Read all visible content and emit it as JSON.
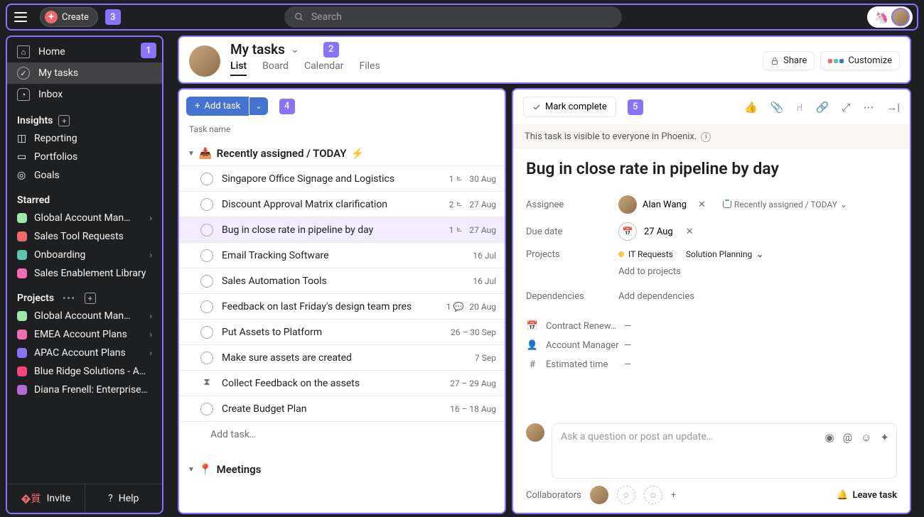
{
  "topbar": {
    "create_label": "Create",
    "badge": "3",
    "search_placeholder": "Search"
  },
  "sidebar": {
    "badge": "1",
    "nav": [
      {
        "label": "Home"
      },
      {
        "label": "My tasks"
      },
      {
        "label": "Inbox"
      }
    ],
    "insights_label": "Insights",
    "insights": [
      {
        "label": "Reporting"
      },
      {
        "label": "Portfolios"
      },
      {
        "label": "Goals"
      }
    ],
    "starred_label": "Starred",
    "starred": [
      {
        "label": "Global Account Man…",
        "color": "#9ee7a5",
        "chev": true
      },
      {
        "label": "Sales Tool Requests",
        "color": "#f06a6a"
      },
      {
        "label": "Onboarding",
        "color": "#5cc6b0",
        "chev": true
      },
      {
        "label": "Sales Enablement Library",
        "color": "#f56eb4"
      }
    ],
    "projects_label": "Projects",
    "projects": [
      {
        "label": "Global Account Man…",
        "color": "#9ee7a5",
        "chev": true
      },
      {
        "label": "EMEA Account Plans",
        "color": "#f56eb4",
        "chev": true
      },
      {
        "label": "APAC Account Plans",
        "color": "#8a72ff",
        "chev": true
      },
      {
        "label": "Blue Ridge Solutions - A…",
        "color": "#f8447c"
      },
      {
        "label": "Diana Frenell: Enterprise…",
        "color": "#b36bd4"
      }
    ],
    "invite_label": "Invite",
    "help_label": "Help"
  },
  "header": {
    "title": "My tasks",
    "badge": "2",
    "tabs": [
      "List",
      "Board",
      "Calendar",
      "Files"
    ],
    "share_label": "Share",
    "customize_label": "Customize"
  },
  "list": {
    "add_task_label": "Add task",
    "badge": "4",
    "column_label": "Task name",
    "section1_label": "Recently assigned / TODAY",
    "tasks": [
      {
        "name": "Singapore Office Signage and Logistics",
        "sub": "1",
        "date": "30 Aug"
      },
      {
        "name": "Discount Approval Matrix clarification",
        "sub": "2",
        "date": "27 Aug"
      },
      {
        "name": "Bug in close rate in pipeline by day",
        "sub": "1",
        "date": "27 Aug",
        "selected": true
      },
      {
        "name": "Email Tracking Software",
        "date": "16 Jul"
      },
      {
        "name": "Sales Automation Tools",
        "date": "16 Jul"
      },
      {
        "name": "Feedback on last Friday's design team pres",
        "comment": "1",
        "date": "20 Aug"
      },
      {
        "name": "Put Assets to Platform",
        "date": "26 – 30 Sep"
      },
      {
        "name": "Make sure assets are created",
        "date": "7 Sep"
      },
      {
        "name": "Collect Feedback on the assets",
        "hourglass": true,
        "date": "27 – 29 Aug"
      },
      {
        "name": "Create Budget Plan",
        "date": "16 – 18 Aug"
      }
    ],
    "add_task_inline": "Add task…",
    "section2_label": "Meetings"
  },
  "detail": {
    "mark_complete": "Mark complete",
    "badge": "5",
    "visibility_text": "This task is visible to everyone in Phoenix.",
    "title": "Bug in close rate in pipeline by day",
    "labels": {
      "assignee": "Assignee",
      "due_date": "Due date",
      "projects": "Projects",
      "dependencies": "Dependencies"
    },
    "assignee_name": "Alan Wang",
    "assignee_section": "Recently assigned / TODAY",
    "due_date_value": "27 Aug",
    "project_chips": [
      {
        "name": "IT Requests",
        "color": "#f2c94c"
      },
      {
        "name": "Solution Planning",
        "chev": true
      }
    ],
    "add_to_projects": "Add to projects",
    "add_dependencies": "Add dependencies",
    "custom_fields": [
      {
        "icon": "cal",
        "label": "Contract Renew…",
        "value": "—"
      },
      {
        "icon": "person",
        "label": "Account Manager",
        "value": "—"
      },
      {
        "icon": "hash",
        "label": "Estimated time",
        "value": "—"
      }
    ],
    "comment_placeholder": "Ask a question or post an update…",
    "collaborators_label": "Collaborators",
    "leave_task_label": "Leave task"
  }
}
